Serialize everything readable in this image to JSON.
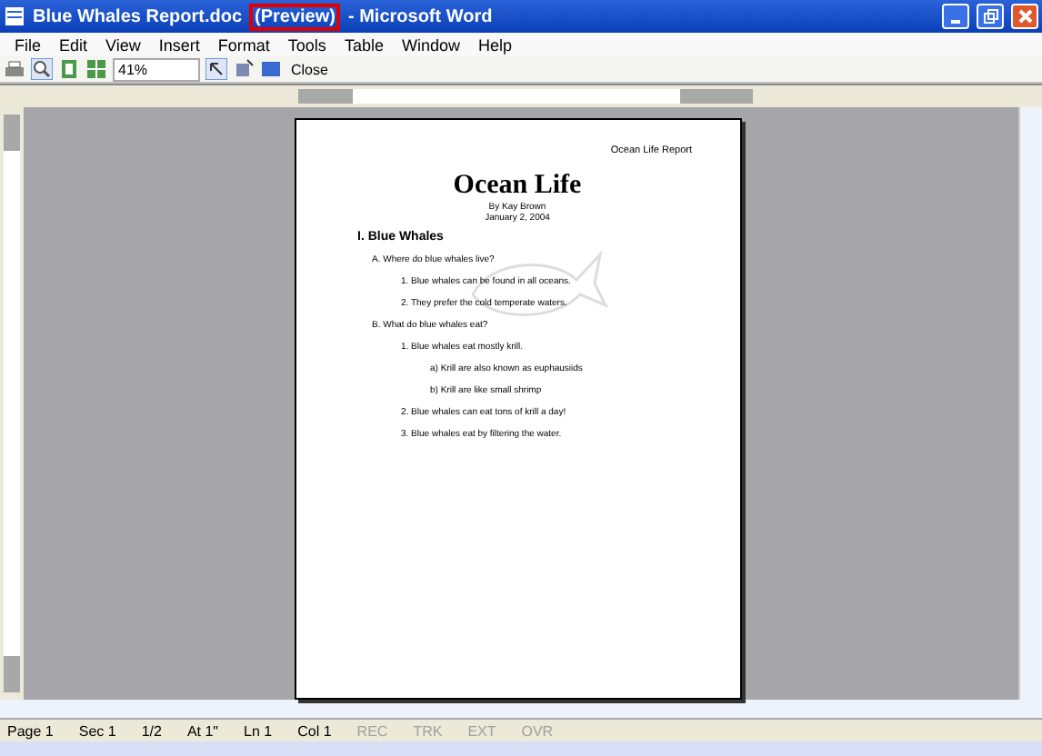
{
  "window": {
    "title": "Blue Whales Report.doc",
    "title_tag": "(Preview)",
    "title_suffix": "- Microsoft Word"
  },
  "menu": [
    "File",
    "Edit",
    "View",
    "Insert",
    "Format",
    "Tools",
    "Table",
    "Window",
    "Help"
  ],
  "toolbar": {
    "zoom": "41%",
    "close": "Close"
  },
  "document": {
    "header": "Ocean Life Report",
    "title": "Ocean Life",
    "author": "By Kay Brown",
    "date": "January 2, 2004",
    "heading": "I. Blue Whales",
    "outline": [
      {
        "text": "A. Where do blue whales live?",
        "children": [
          {
            "text": "1. Blue whales can be found in all oceans."
          },
          {
            "text": "2. They prefer the cold temperate waters."
          }
        ]
      },
      {
        "text": "B. What do blue whales eat?",
        "children": [
          {
            "text": "1. Blue whales eat mostly krill.",
            "children": [
              {
                "text": "a) Krill are also known as euphausiids"
              },
              {
                "text": "b) Krill are like small shrimp"
              }
            ]
          },
          {
            "text": "2. Blue whales can eat tons of krill a day!"
          },
          {
            "text": "3. Blue whales eat by filtering the water."
          }
        ]
      }
    ]
  },
  "status_bar": [
    "Page 1",
    "Sec 1",
    "1/2",
    "At 1\"",
    "Ln 1",
    "Col 1"
  ],
  "modes": [
    {
      "label": "REC",
      "on": false
    },
    {
      "label": "TRK",
      "on": false
    },
    {
      "label": "EXT",
      "on": false
    },
    {
      "label": "OVR",
      "on": false
    }
  ]
}
